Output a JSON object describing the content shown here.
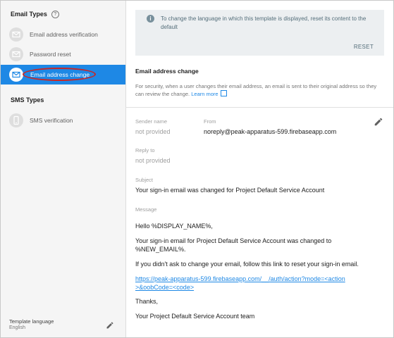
{
  "sidebar": {
    "email_types_heading": "Email Types",
    "sms_types_heading": "SMS Types",
    "email_items": [
      {
        "label": "Email address verification"
      },
      {
        "label": "Password reset"
      },
      {
        "label": "Email address change"
      }
    ],
    "sms_items": [
      {
        "label": "SMS verification"
      }
    ],
    "template_language_label": "Template language",
    "template_language_value": "English"
  },
  "notice": {
    "text": "To change the language in which this template is displayed, reset its content to the default",
    "reset_label": "RESET"
  },
  "template": {
    "title": "Email address change",
    "description": "For security, when a user changes their email address, an email is sent to their original address so they can review the change.",
    "learn_more": "Learn more"
  },
  "fields": {
    "sender_name_label": "Sender name",
    "sender_name_value": "not provided",
    "from_label": "From",
    "from_value": "noreply@peak-apparatus-599.firebaseapp.com",
    "reply_to_label": "Reply to",
    "reply_to_value": "not provided",
    "subject_label": "Subject",
    "subject_value": "Your sign-in email was changed for Project Default Service Account",
    "message_label": "Message"
  },
  "message": {
    "greeting": "Hello %DISPLAY_NAME%,",
    "body1": "Your sign-in email for Project Default Service Account was changed to %NEW_EMAIL%.",
    "body2": "If you didn't ask to change your email, follow this link to reset your sign-in email.",
    "link": "https://peak-apparatus-599.firebaseapp.com/__/auth/action?mode=<action>&oobCode=<code>",
    "thanks": "Thanks,",
    "signature": "Your Project Default Service Account team"
  },
  "colors": {
    "accent": "#1e88e5",
    "highlight_circle": "#c62828"
  }
}
